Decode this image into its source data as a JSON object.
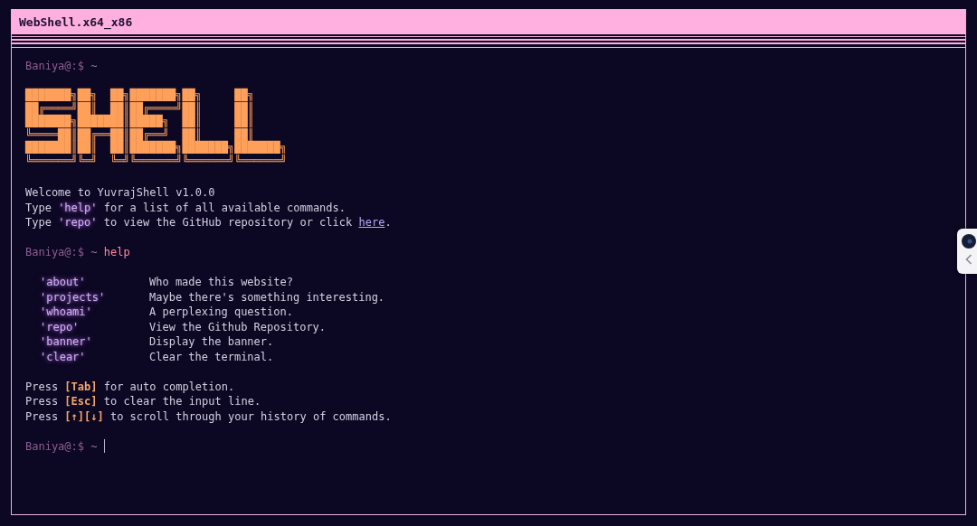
{
  "window": {
    "title": "WebShell.x64_x86"
  },
  "terminal": [
    {
      "kind": "prompt",
      "user": "Baniya@:$",
      "path": "~",
      "cursor": false
    },
    {
      "kind": "banner",
      "lines": [
        "███████╗██╗  ██╗███████╗██╗     ██╗",
        "██╔════╝██║  ██║██╔════╝██║     ██║",
        "███████╗███████║█████╗  ██║     ██║",
        "╚════██║██╔══██║██╔══╝  ██║     ██║",
        "███████║██║  ██║███████╗███████╗███████╗",
        "╚══════╝╚═╝  ╚═╝╚══════╝╚══════╝╚══════╝"
      ]
    },
    {
      "kind": "text",
      "lines": [
        [
          {
            "kind": "plain",
            "text": "Welcome to YuvrajShell v1.0.0"
          }
        ],
        [
          {
            "kind": "plain",
            "text": "Type "
          },
          {
            "kind": "command",
            "text": "'help'"
          },
          {
            "kind": "plain",
            "text": " for a list of all available commands."
          }
        ],
        [
          {
            "kind": "plain",
            "text": "Type "
          },
          {
            "kind": "command",
            "text": "'repo'"
          },
          {
            "kind": "plain",
            "text": " to view the GitHub repository or click "
          },
          {
            "kind": "link",
            "text": "here"
          },
          {
            "kind": "plain",
            "text": "."
          }
        ]
      ]
    },
    {
      "kind": "prompt",
      "user": "Baniya@:$",
      "path": "~",
      "command": "help",
      "cursor": false
    },
    {
      "kind": "help",
      "rows": [
        {
          "command": "'about'",
          "description": "Who made this website?"
        },
        {
          "command": "'projects'",
          "description": "Maybe there's something interesting."
        },
        {
          "command": "'whoami'",
          "description": "A perplexing question."
        },
        {
          "command": "'repo'",
          "description": "View the Github Repository."
        },
        {
          "command": "'banner'",
          "description": "Display the banner."
        },
        {
          "command": "'clear'",
          "description": "Clear the terminal."
        }
      ]
    },
    {
      "kind": "text",
      "lines": [
        [
          {
            "kind": "plain",
            "text": "Press "
          },
          {
            "kind": "key",
            "text": "[Tab]"
          },
          {
            "kind": "plain",
            "text": " for auto completion."
          }
        ],
        [
          {
            "kind": "plain",
            "text": "Press "
          },
          {
            "kind": "key",
            "text": "[Esc]"
          },
          {
            "kind": "plain",
            "text": " to clear the input line."
          }
        ],
        [
          {
            "kind": "plain",
            "text": "Press "
          },
          {
            "kind": "key",
            "text": "[↑][↓]"
          },
          {
            "kind": "plain",
            "text": " to scroll through your history of commands."
          }
        ]
      ]
    },
    {
      "kind": "prompt",
      "user": "Baniya@:$",
      "path": "~",
      "cursor": true
    }
  ]
}
